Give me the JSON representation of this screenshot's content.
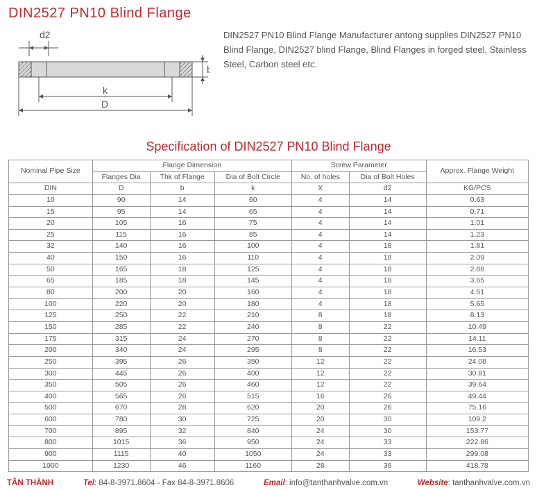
{
  "title": "DIN2527 PN10 Blind Flange",
  "description": "DIN2527 PN10 Blind Flange Manufacturer antong supplies DIN2527 PN10 Blind Flange, DIN2527 blind Flange, Blind Flanges in forged steel, Stainless Steel, Carbon steel etc.",
  "subtitle": "Specification of DIN2527 PN10 Blind Flange",
  "diagram_labels": {
    "d2": "d2",
    "b": "b",
    "k": "k",
    "D": "D"
  },
  "headers": {
    "nominal": "Nominal Pipe Size",
    "flange_dim": "Flange Dimension",
    "screw_param": "Screw Parameter",
    "weight": "Approx. Flange Weight",
    "flanges_dia": "Flanges Dia",
    "thk": "Thk of Flange",
    "bolt_circle": "Dia of Bolt Circle",
    "holes": "No. of holes",
    "bolt_holes": "Dia of Bolt Holes",
    "din": "DIN",
    "D": "D",
    "b": "b",
    "k": "k",
    "X": "X",
    "d2": "d2",
    "kg": "KG/PCS"
  },
  "rows": [
    {
      "din": "10",
      "D": "90",
      "b": "14",
      "k": "60",
      "X": "4",
      "d2": "14",
      "kg": "0.63"
    },
    {
      "din": "15",
      "D": "95",
      "b": "14",
      "k": "65",
      "X": "4",
      "d2": "14",
      "kg": "0.71"
    },
    {
      "din": "20",
      "D": "105",
      "b": "16",
      "k": "75",
      "X": "4",
      "d2": "14",
      "kg": "1.01"
    },
    {
      "din": "25",
      "D": "115",
      "b": "16",
      "k": "85",
      "X": "4",
      "d2": "14",
      "kg": "1.23"
    },
    {
      "din": "32",
      "D": "140",
      "b": "16",
      "k": "100",
      "X": "4",
      "d2": "18",
      "kg": "1.81"
    },
    {
      "din": "40",
      "D": "150",
      "b": "16",
      "k": "110",
      "X": "4",
      "d2": "18",
      "kg": "2.09"
    },
    {
      "din": "50",
      "D": "165",
      "b": "18",
      "k": "125",
      "X": "4",
      "d2": "18",
      "kg": "2.88"
    },
    {
      "din": "65",
      "D": "185",
      "b": "18",
      "k": "145",
      "X": "4",
      "d2": "18",
      "kg": "3.65"
    },
    {
      "din": "80",
      "D": "200",
      "b": "20",
      "k": "160",
      "X": "4",
      "d2": "18",
      "kg": "4.61"
    },
    {
      "din": "100",
      "D": "220",
      "b": "20",
      "k": "180",
      "X": "4",
      "d2": "18",
      "kg": "5.65"
    },
    {
      "din": "125",
      "D": "250",
      "b": "22",
      "k": "210",
      "X": "8",
      "d2": "18",
      "kg": "8.13"
    },
    {
      "din": "150",
      "D": "285",
      "b": "22",
      "k": "240",
      "X": "8",
      "d2": "22",
      "kg": "10.49"
    },
    {
      "din": "175",
      "D": "315",
      "b": "24",
      "k": "270",
      "X": "8",
      "d2": "22",
      "kg": "14.11"
    },
    {
      "din": "200",
      "D": "340",
      "b": "24",
      "k": "295",
      "X": "8",
      "d2": "22",
      "kg": "16.53"
    },
    {
      "din": "250",
      "D": "395",
      "b": "26",
      "k": "350",
      "X": "12",
      "d2": "22",
      "kg": "24.08"
    },
    {
      "din": "300",
      "D": "445",
      "b": "26",
      "k": "400",
      "X": "12",
      "d2": "22",
      "kg": "30.81"
    },
    {
      "din": "350",
      "D": "505",
      "b": "26",
      "k": "460",
      "X": "12",
      "d2": "22",
      "kg": "39.64"
    },
    {
      "din": "400",
      "D": "565",
      "b": "26",
      "k": "515",
      "X": "16",
      "d2": "26",
      "kg": "49.44"
    },
    {
      "din": "500",
      "D": "670",
      "b": "28",
      "k": "620",
      "X": "20",
      "d2": "26",
      "kg": "75.16"
    },
    {
      "din": "600",
      "D": "780",
      "b": "30",
      "k": "725",
      "X": "20",
      "d2": "30",
      "kg": "109.2"
    },
    {
      "din": "700",
      "D": "895",
      "b": "32",
      "k": "840",
      "X": "24",
      "d2": "30",
      "kg": "153.77"
    },
    {
      "din": "800",
      "D": "1015",
      "b": "36",
      "k": "950",
      "X": "24",
      "d2": "33",
      "kg": "222.86"
    },
    {
      "din": "900",
      "D": "1115",
      "b": "40",
      "k": "1050",
      "X": "24",
      "d2": "33",
      "kg": "299.08"
    },
    {
      "din": "1000",
      "D": "1230",
      "b": "46",
      "k": "1160",
      "X": "28",
      "d2": "36",
      "kg": "418.78"
    }
  ],
  "footer": {
    "brand": "TÂN THÀNH",
    "tel_label": "Tel",
    "tel": ": 84-8-3971.8604 - Fax 84-8-3971.8606",
    "email_label": "Email",
    "email": ": info@tanthanhvalve.com.vn",
    "web_label": "Website",
    "web": ": tanthanhvalve.com.vn"
  }
}
